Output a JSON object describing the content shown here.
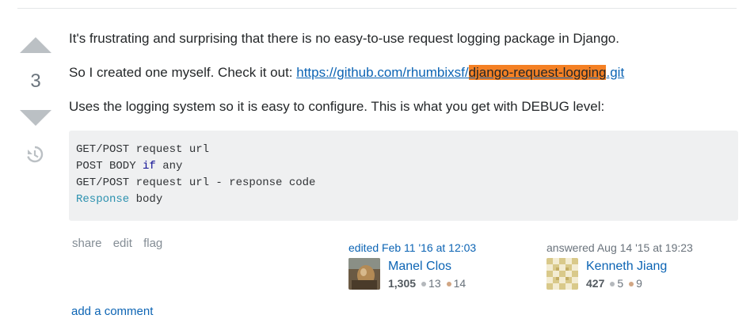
{
  "vote": {
    "count": "3"
  },
  "post": {
    "p1": "It's frustrating and surprising that there is no easy-to-use request logging package in Django.",
    "p2_prefix": "So I created one myself. Check it out: ",
    "link_part1": "https://github.com/rhumbixsf/",
    "link_highlight": "django-request-logging",
    "link_part2": ".git",
    "p3": "Uses the logging system so it is easy to configure. This is what you get with DEBUG level:",
    "code": {
      "line1": "GET/POST request url",
      "line2_a": "POST BODY ",
      "line2_kw": "if",
      "line2_b": " any",
      "line3": "GET/POST request url - response code",
      "line4_type": "Response",
      "line4_b": " body"
    }
  },
  "menu": {
    "share": "share",
    "edit": "edit",
    "flag": "flag"
  },
  "editor": {
    "action": "edited Feb 11 '16 at 12:03",
    "name": "Manel Clos",
    "reputation": "1,305",
    "silver": "13",
    "bronze": "14"
  },
  "author": {
    "action": "answered Aug 14 '15 at 19:23",
    "name": "Kenneth Jiang",
    "reputation": "427",
    "silver": "5",
    "bronze": "9"
  },
  "comments": {
    "add_label": "add a comment"
  },
  "colors": {
    "accent": "#0c64b4",
    "highlight": "#f48024",
    "code_bg": "#eff0f1"
  },
  "icons": {
    "up": "arrow-up-icon",
    "down": "arrow-down-icon",
    "history": "history-icon"
  }
}
